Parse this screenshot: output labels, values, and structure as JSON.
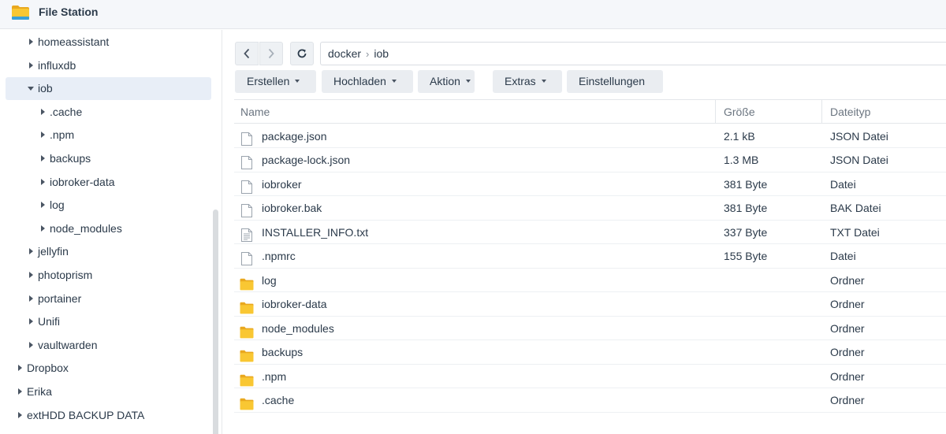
{
  "app": {
    "title": "File Station",
    "icon": "folder-icon"
  },
  "sidebar": {
    "items": [
      {
        "label": "homeassistant",
        "level": 1,
        "state": "collapsed"
      },
      {
        "label": "influxdb",
        "level": 1,
        "state": "collapsed"
      },
      {
        "label": "iob",
        "level": 1,
        "state": "expanded",
        "selected": true
      },
      {
        "label": ".cache",
        "level": 2,
        "state": "collapsed"
      },
      {
        "label": ".npm",
        "level": 2,
        "state": "collapsed"
      },
      {
        "label": "backups",
        "level": 2,
        "state": "collapsed"
      },
      {
        "label": "iobroker-data",
        "level": 2,
        "state": "collapsed"
      },
      {
        "label": "log",
        "level": 2,
        "state": "collapsed"
      },
      {
        "label": "node_modules",
        "level": 2,
        "state": "collapsed"
      },
      {
        "label": "jellyfin",
        "level": 1,
        "state": "collapsed"
      },
      {
        "label": "photoprism",
        "level": 1,
        "state": "collapsed"
      },
      {
        "label": "portainer",
        "level": 1,
        "state": "collapsed"
      },
      {
        "label": "Unifi",
        "level": 1,
        "state": "collapsed"
      },
      {
        "label": "vaultwarden",
        "level": 1,
        "state": "collapsed"
      },
      {
        "label": "Dropbox",
        "level": 0,
        "state": "collapsed"
      },
      {
        "label": "Erika",
        "level": 0,
        "state": "collapsed"
      },
      {
        "label": "extHDD BACKUP DATA",
        "level": 0,
        "state": "collapsed"
      }
    ]
  },
  "nav": {
    "back_icon": "chevron-left-icon",
    "forward_icon": "chevron-right-icon",
    "refresh_icon": "refresh-icon",
    "breadcrumb": [
      "docker",
      "iob"
    ]
  },
  "toolbar": {
    "buttons": [
      {
        "label": "Erstellen",
        "dropdown": true
      },
      {
        "label": "Hochladen",
        "dropdown": true
      },
      {
        "label": "Aktion",
        "dropdown": true
      },
      {
        "label": "Extras",
        "dropdown": true
      },
      {
        "label": "Einstellungen",
        "dropdown": false
      }
    ]
  },
  "table": {
    "columns": [
      "Name",
      "Größe",
      "Dateityp"
    ],
    "rows": [
      {
        "name": "package.json",
        "size": "2.1 kB",
        "type": "JSON Datei",
        "icon": "file-icon"
      },
      {
        "name": "package-lock.json",
        "size": "1.3 MB",
        "type": "JSON Datei",
        "icon": "file-icon"
      },
      {
        "name": "iobroker",
        "size": "381 Byte",
        "type": "Datei",
        "icon": "file-icon"
      },
      {
        "name": "iobroker.bak",
        "size": "381 Byte",
        "type": "BAK Datei",
        "icon": "file-icon"
      },
      {
        "name": "INSTALLER_INFO.txt",
        "size": "337 Byte",
        "type": "TXT Datei",
        "icon": "text-file-icon"
      },
      {
        "name": ".npmrc",
        "size": "155 Byte",
        "type": "Datei",
        "icon": "file-icon"
      },
      {
        "name": "log",
        "size": "",
        "type": "Ordner",
        "icon": "folder-icon"
      },
      {
        "name": "iobroker-data",
        "size": "",
        "type": "Ordner",
        "icon": "folder-icon"
      },
      {
        "name": "node_modules",
        "size": "",
        "type": "Ordner",
        "icon": "folder-icon"
      },
      {
        "name": "backups",
        "size": "",
        "type": "Ordner",
        "icon": "folder-icon"
      },
      {
        "name": ".npm",
        "size": "",
        "type": "Ordner",
        "icon": "folder-icon"
      },
      {
        "name": ".cache",
        "size": "",
        "type": "Ordner",
        "icon": "folder-icon"
      }
    ]
  },
  "colors": {
    "accent_selected": "#e8eef7",
    "folder": "#f9c733",
    "text": "#2b3a4a"
  }
}
